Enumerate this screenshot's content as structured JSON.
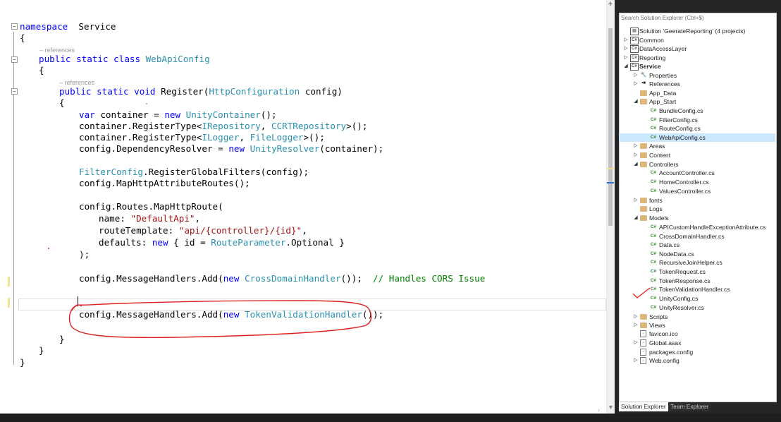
{
  "editor": {
    "references_label": "– references",
    "lines": {
      "l1": {
        "kw1": "namespace",
        "t1": "  Service"
      },
      "l2": {
        "t1": "{"
      },
      "l3": {
        "kw1": "public",
        "kw2": " static",
        "kw3": " class",
        "ty1": " WebApiConfig"
      },
      "l4": {
        "t1": "{"
      },
      "l5": {
        "kw1": "public",
        "kw2": " static",
        "kw3": " void",
        "t1": " Register(",
        "ty1": "HttpConfiguration",
        "t2": " config)"
      },
      "l6": {
        "t1": "{"
      },
      "l7": {
        "kw1": "var",
        "t1": " container = ",
        "kw2": "new",
        "t2": " ",
        "ty1": "UnityContainer",
        "t3": "();"
      },
      "l8": {
        "t1": "container.RegisterType<",
        "ty1": "IRepository",
        "t2": ", ",
        "ty2": "CCRTRepository",
        "t3": ">();"
      },
      "l9": {
        "t1": "container.RegisterType<",
        "ty1": "ILogger",
        "t2": ", ",
        "ty2": "FileLogger",
        "t3": ">();"
      },
      "l10": {
        "t1": "config.DependencyResolver = ",
        "kw1": "new",
        "t2": " ",
        "ty1": "UnityResolver",
        "t3": "(container);"
      },
      "l11": {
        "ty1": "FilterConfig",
        "t1": ".RegisterGlobalFilters(config);"
      },
      "l12": {
        "t1": "config.MapHttpAttributeRoutes();"
      },
      "l13": {
        "t1": "config.Routes.MapHttpRoute("
      },
      "l14": {
        "t1": "name: ",
        "st1": "\"DefaultApi\"",
        "t2": ","
      },
      "l15": {
        "t1": "routeTemplate: ",
        "st1": "\"api/{controller}/{id}\"",
        "t2": ","
      },
      "l16": {
        "t1": "defaults: ",
        "kw1": "new",
        "t2": " { id = ",
        "ty1": "RouteParameter",
        "t3": ".Optional }"
      },
      "l17": {
        "t1": ");"
      },
      "l18": {
        "t1": "config.MessageHandlers.Add(",
        "kw1": "new",
        "t2": " ",
        "ty1": "CrossDomainHandler",
        "t3": "());  ",
        "cm1": "// Handles CORS Issue"
      },
      "l19": {
        "t1": "config.MessageHandlers.Add(",
        "kw1": "new",
        "t2": " ",
        "ty1": "TokenValidationHandler",
        "t3": "());"
      },
      "l20": {
        "t1": "}"
      },
      "l21": {
        "t1": "}"
      },
      "l22": {
        "t1": "}"
      }
    }
  },
  "solution_explorer": {
    "search_placeholder": "Search Solution Explorer (Ctrl+$)",
    "items": [
      {
        "label": "Solution 'GeerateReporting' (4 projects)"
      },
      {
        "label": "Common"
      },
      {
        "label": "DataAccessLayer"
      },
      {
        "label": "Reporting"
      },
      {
        "label": "Service"
      },
      {
        "label": "Properties"
      },
      {
        "label": "References"
      },
      {
        "label": "App_Data"
      },
      {
        "label": "App_Start"
      },
      {
        "label": "BundleConfig.cs"
      },
      {
        "label": "FilterConfig.cs"
      },
      {
        "label": "RouteConfig.cs"
      },
      {
        "label": "WebApiConfig.cs"
      },
      {
        "label": "Areas"
      },
      {
        "label": "Content"
      },
      {
        "label": "Controllers"
      },
      {
        "label": "AccountController.cs"
      },
      {
        "label": "HomeController.cs"
      },
      {
        "label": "ValuesController.cs"
      },
      {
        "label": "fonts"
      },
      {
        "label": "Logs"
      },
      {
        "label": "Models"
      },
      {
        "label": "APICustomHandleExceptionAttribute.cs"
      },
      {
        "label": "CrossDomainHandler.cs"
      },
      {
        "label": "Data.cs"
      },
      {
        "label": "NodeData.cs"
      },
      {
        "label": "RecursiveJoinHelper.cs"
      },
      {
        "label": "TokenRequest.cs"
      },
      {
        "label": "TokenResponse.cs"
      },
      {
        "label": "TokenValidationHandler.cs"
      },
      {
        "label": "UnityConfig.cs"
      },
      {
        "label": "UnityResolver.cs"
      },
      {
        "label": "Scripts"
      },
      {
        "label": "Views"
      },
      {
        "label": "favicon.ico"
      },
      {
        "label": "Global.asax"
      },
      {
        "label": "packages.config"
      },
      {
        "label": "Web.config"
      }
    ],
    "tabs": {
      "solution_explorer": "Solution Explorer",
      "team_explorer": "Team Explorer"
    }
  },
  "colors": {
    "keyword": "#0000ff",
    "type": "#2b91af",
    "string": "#a31515",
    "comment": "#008000",
    "selection": "#cce8ff",
    "annotation": "#e02020"
  }
}
